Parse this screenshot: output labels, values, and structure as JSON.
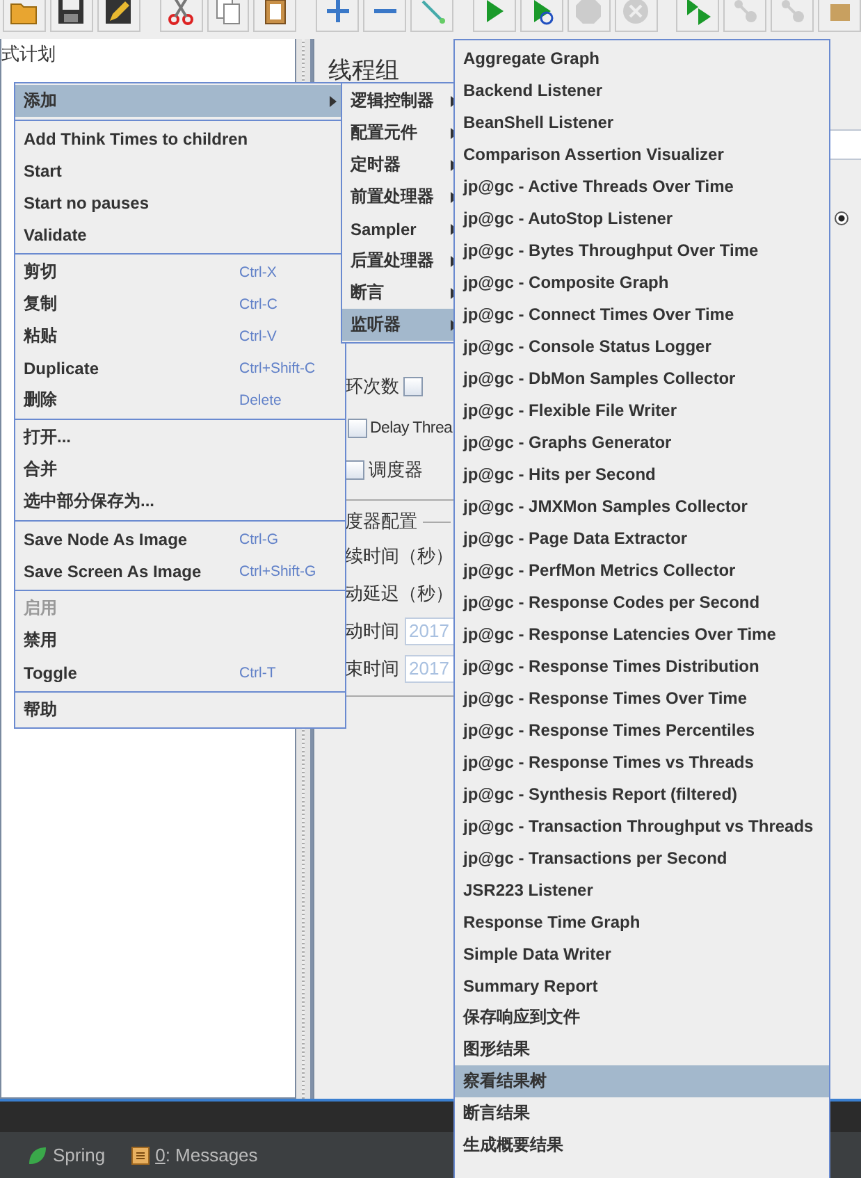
{
  "tree": {
    "items": [
      {
        "label": "式计划",
        "selected": false
      }
    ]
  },
  "thread_group": {
    "title": "线程组",
    "loop_label": "环次数",
    "loop_checked": false,
    "delay_label": "Delay Threa",
    "delay_checked": false,
    "scheduler_label": "调度器",
    "scheduler_checked": false,
    "scheduler_config": {
      "legend": "度器配置",
      "fields": [
        {
          "label": "续时间（秒）"
        },
        {
          "label": "动延迟（秒）"
        },
        {
          "label": "动时间",
          "placeholder": "2017"
        },
        {
          "label": "束时间",
          "placeholder": "2017"
        }
      ]
    },
    "edge_radio": {
      "selected": true
    }
  },
  "context_menu": {
    "groups": [
      [
        {
          "label": "添加",
          "submenu": true,
          "selected": true,
          "disabled": false
        }
      ],
      [
        {
          "label": "Add Think Times to children",
          "submenu": false,
          "selected": false,
          "disabled": false
        },
        {
          "label": "Start",
          "submenu": false,
          "selected": false,
          "disabled": false
        },
        {
          "label": "Start no pauses",
          "submenu": false,
          "selected": false,
          "disabled": false
        },
        {
          "label": "Validate",
          "submenu": false,
          "selected": false,
          "disabled": false
        }
      ],
      [
        {
          "label": "剪切",
          "shortcut": "Ctrl-X",
          "submenu": false,
          "selected": false,
          "disabled": false
        },
        {
          "label": "复制",
          "shortcut": "Ctrl-C",
          "submenu": false,
          "selected": false,
          "disabled": false
        },
        {
          "label": "粘贴",
          "shortcut": "Ctrl-V",
          "submenu": false,
          "selected": false,
          "disabled": false
        },
        {
          "label": "Duplicate",
          "shortcut": "Ctrl+Shift-C",
          "submenu": false,
          "selected": false,
          "disabled": false
        },
        {
          "label": "删除",
          "shortcut": "Delete",
          "submenu": false,
          "selected": false,
          "disabled": false
        }
      ],
      [
        {
          "label": "打开...",
          "submenu": false,
          "selected": false,
          "disabled": false
        },
        {
          "label": "合并",
          "submenu": false,
          "selected": false,
          "disabled": false
        },
        {
          "label": "选中部分保存为...",
          "submenu": false,
          "selected": false,
          "disabled": false
        }
      ],
      [
        {
          "label": "Save Node As Image",
          "shortcut": "Ctrl-G",
          "submenu": false,
          "selected": false,
          "disabled": false
        },
        {
          "label": "Save Screen As Image",
          "shortcut": "Ctrl+Shift-G",
          "submenu": false,
          "selected": false,
          "disabled": false
        }
      ],
      [
        {
          "label": "启用",
          "submenu": false,
          "selected": false,
          "disabled": true
        },
        {
          "label": "禁用",
          "submenu": false,
          "selected": false,
          "disabled": false
        },
        {
          "label": "Toggle",
          "shortcut": "Ctrl-T",
          "submenu": false,
          "selected": false,
          "disabled": false
        }
      ],
      [
        {
          "label": "帮助",
          "submenu": false,
          "selected": false,
          "disabled": false
        }
      ]
    ]
  },
  "add_submenu": {
    "items": [
      {
        "label": "逻辑控制器",
        "selected": false
      },
      {
        "label": "配置元件",
        "selected": false
      },
      {
        "label": "定时器",
        "selected": false
      },
      {
        "label": "前置处理器",
        "selected": false
      },
      {
        "label": "Sampler",
        "selected": false
      },
      {
        "label": "后置处理器",
        "selected": false
      },
      {
        "label": "断言",
        "selected": false
      },
      {
        "label": "监听器",
        "selected": true
      }
    ]
  },
  "listener_submenu": {
    "items": [
      {
        "label": "Aggregate Graph",
        "selected": false
      },
      {
        "label": "Backend Listener",
        "selected": false
      },
      {
        "label": "BeanShell Listener",
        "selected": false
      },
      {
        "label": "Comparison Assertion Visualizer",
        "selected": false
      },
      {
        "label": "jp@gc - Active Threads Over Time",
        "selected": false
      },
      {
        "label": "jp@gc - AutoStop Listener",
        "selected": false
      },
      {
        "label": "jp@gc - Bytes Throughput Over Time",
        "selected": false
      },
      {
        "label": "jp@gc - Composite Graph",
        "selected": false
      },
      {
        "label": "jp@gc - Connect Times Over Time",
        "selected": false
      },
      {
        "label": "jp@gc - Console Status Logger",
        "selected": false
      },
      {
        "label": "jp@gc - DbMon Samples Collector",
        "selected": false
      },
      {
        "label": "jp@gc - Flexible File Writer",
        "selected": false
      },
      {
        "label": "jp@gc - Graphs Generator",
        "selected": false
      },
      {
        "label": "jp@gc - Hits per Second",
        "selected": false
      },
      {
        "label": "jp@gc - JMXMon Samples Collector",
        "selected": false
      },
      {
        "label": "jp@gc - Page Data Extractor",
        "selected": false
      },
      {
        "label": "jp@gc - PerfMon Metrics Collector",
        "selected": false
      },
      {
        "label": "jp@gc - Response Codes per Second",
        "selected": false
      },
      {
        "label": "jp@gc - Response Latencies Over Time",
        "selected": false
      },
      {
        "label": "jp@gc - Response Times Distribution",
        "selected": false
      },
      {
        "label": "jp@gc - Response Times Over Time",
        "selected": false
      },
      {
        "label": "jp@gc - Response Times Percentiles",
        "selected": false
      },
      {
        "label": "jp@gc - Response Times vs Threads",
        "selected": false
      },
      {
        "label": "jp@gc - Synthesis Report (filtered)",
        "selected": false
      },
      {
        "label": "jp@gc - Transaction Throughput vs Threads",
        "selected": false
      },
      {
        "label": "jp@gc - Transactions per Second",
        "selected": false
      },
      {
        "label": "JSR223 Listener",
        "selected": false
      },
      {
        "label": "Response Time Graph",
        "selected": false
      },
      {
        "label": "Simple Data Writer",
        "selected": false
      },
      {
        "label": "Summary Report",
        "selected": false
      },
      {
        "label": "保存响应到文件",
        "selected": false
      },
      {
        "label": "图形结果",
        "selected": false
      },
      {
        "label": "察看结果树",
        "selected": true
      },
      {
        "label": "断言结果",
        "selected": false
      },
      {
        "label": "生成概要结果",
        "selected": false
      }
    ]
  },
  "status_bar": {
    "items": [
      {
        "kind": "spring",
        "label": "Spring"
      },
      {
        "kind": "messages",
        "mnemonic": "0",
        "label": ": Messages"
      }
    ]
  }
}
